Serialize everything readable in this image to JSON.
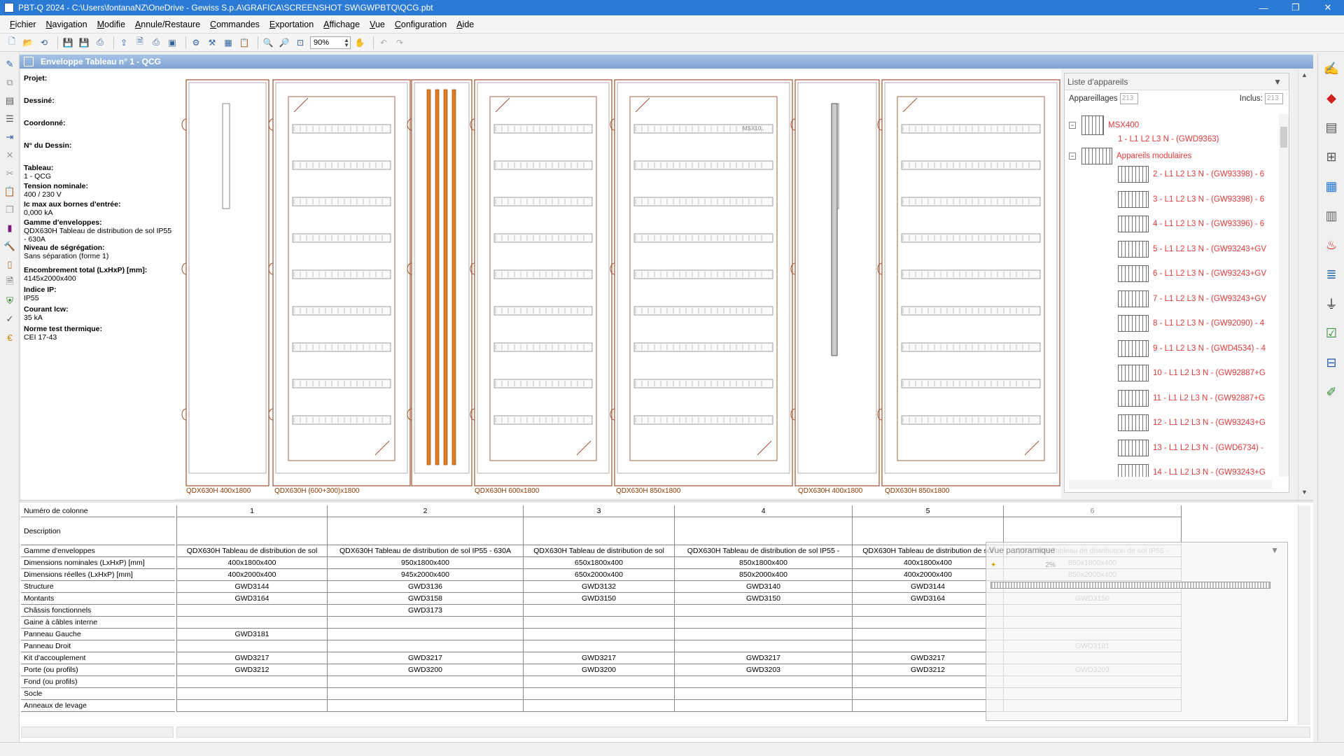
{
  "window": {
    "title": "PBT-Q 2024 - C:\\Users\\fontanaNZ\\OneDrive - Gewiss S.p.A\\GRAFICA\\SCREENSHOT SW\\GWPBTQ\\QCG.pbt",
    "minimize": "—",
    "maximize": "❐",
    "close": "✕"
  },
  "menu": [
    "Fichier",
    "Navigation",
    "Modifie",
    "Annule/Restaure",
    "Commandes",
    "Exportation",
    "Affichage",
    "Vue",
    "Configuration",
    "Aide"
  ],
  "toolbar": {
    "zoom": "90%"
  },
  "document": {
    "title": "Enveloppe Tableau n° 1 - QCG"
  },
  "info": {
    "projet_label": "Projet:",
    "dessine_label": "Dessiné:",
    "coordonne_label": "Coordonné:",
    "dessin_label": "N° du Dessin:",
    "tableau_label": "Tableau:",
    "tableau_value": "1 - QCG",
    "tension_label": "Tension nominale:",
    "tension_value": "400 / 230 V",
    "icmax_label": "Ic max aux bornes d'entrée:",
    "icmax_value": "0,000 kA",
    "gamme_label": "Gamme d'enveloppes:",
    "gamme_value": "QDX630H Tableau de distribution de sol IP55 - 630A",
    "niveau_label": "Niveau de ségrégation:",
    "niveau_value": "Sans séparation (forme 1)",
    "encombrement_label": "Encombrement total (LxHxP) [mm]:",
    "encombrement_value": "4145x2000x400",
    "ip_label": "Indice IP:",
    "ip_value": "IP55",
    "icw_label": "Courant Icw:",
    "icw_value": "35 kA",
    "norme_label": "Norme test thermique:",
    "norme_value": "CEI 17-43"
  },
  "columns_canvas": [
    {
      "label": "QDX630H 400x1800"
    },
    {
      "label": "QDX630H (600+300)x1800"
    },
    {
      "label": "QDX630H 600x1800"
    },
    {
      "label": "QDX630H 850x1800"
    },
    {
      "label": "QDX630H 400x1800"
    },
    {
      "label": "QDX630H 850x1800"
    }
  ],
  "canvas_tags": {
    "msx": "MSX10..",
    "msx2": "MSX400"
  },
  "device_list": {
    "title": "Liste d'appareils",
    "appareillages_label": "Appareillages",
    "appareillages_value": "213",
    "inclus_label": "Inclus:",
    "inclus_value": "213",
    "items": [
      {
        "text": "MSX400",
        "level": 0
      },
      {
        "text": "1 - L1 L2 L3 N - (GWD9363)",
        "level": 1
      },
      {
        "text": "Appareils modulaires",
        "level": 0
      },
      {
        "text": "2 - L1 L2 L3 N - (GW93398) - 6",
        "level": 2
      },
      {
        "text": "3 - L1 L2 L3 N - (GW93398) - 6",
        "level": 2
      },
      {
        "text": "4 - L1 L2 L3 N - (GW93396) - 6",
        "level": 2
      },
      {
        "text": "5 - L1 L2 L3 N - (GW93243+GV",
        "level": 2
      },
      {
        "text": "6 - L1 L2 L3 N - (GW93243+GV",
        "level": 2
      },
      {
        "text": "7 - L1 L2 L3 N - (GW93243+GV",
        "level": 2
      },
      {
        "text": "8 - L1 L2 L3 N - (GW92090) - 4",
        "level": 2
      },
      {
        "text": "9 - L1 L2 L3 N - (GWD4534) - 4",
        "level": 2
      },
      {
        "text": "10 - L1 L2 L3 N - (GW92887+G",
        "level": 2
      },
      {
        "text": "11 - L1 L2 L3 N - (GW92887+G",
        "level": 2
      },
      {
        "text": "12 - L1 L2 L3 N - (GW93243+G",
        "level": 2
      },
      {
        "text": "13 - L1 L2 L3 N - (GWD6734) -",
        "level": 2
      },
      {
        "text": "14 - L1 L2 L3 N - (GW93243+G",
        "level": 2
      }
    ]
  },
  "table": {
    "row_labels": [
      "Numéro de colonne",
      "Description",
      "Gamme d'enveloppes",
      "Dimensions nominales (LxHxP) [mm]",
      "Dimensions réelles (LxHxP) [mm]",
      "Structure",
      "Montants",
      "Châssis fonctionnels",
      "Gaine à câbles interne",
      "Panneau Gauche",
      "Panneau Droit",
      "Kit d'accouplement",
      "Porte (ou profils)",
      "Fond (ou profils)",
      "Socle",
      "Anneaux de levage"
    ],
    "columns": [
      {
        "num": "1",
        "desc": "",
        "gamme": "QDX630H Tableau de distribution de sol",
        "dimnom": "400x1800x400",
        "dimreel": "400x2000x400",
        "structure": "GWD3144",
        "montants": "GWD3164",
        "chassis": "",
        "gaine": "",
        "pgauche": "GWD3181",
        "pdroit": "",
        "kit": "GWD3217",
        "porte": "GWD3212",
        "fond": "",
        "socle": "",
        "anneaux": ""
      },
      {
        "num": "2",
        "desc": "",
        "gamme": "QDX630H Tableau de distribution de sol IP55 - 630A",
        "dimnom": "950x1800x400",
        "dimreel": "945x2000x400",
        "structure": "GWD3136",
        "montants": "GWD3158",
        "chassis": "GWD3173",
        "gaine": "",
        "pgauche": "",
        "pdroit": "",
        "kit": "GWD3217",
        "porte": "GWD3200",
        "fond": "",
        "socle": "",
        "anneaux": ""
      },
      {
        "num": "3",
        "desc": "",
        "gamme": "QDX630H Tableau de distribution de sol",
        "dimnom": "650x1800x400",
        "dimreel": "650x2000x400",
        "structure": "GWD3132",
        "montants": "GWD3150",
        "chassis": "",
        "gaine": "",
        "pgauche": "",
        "pdroit": "",
        "kit": "GWD3217",
        "porte": "GWD3200",
        "fond": "",
        "socle": "",
        "anneaux": ""
      },
      {
        "num": "4",
        "desc": "",
        "gamme": "QDX630H Tableau de distribution de sol IP55 -",
        "dimnom": "850x1800x400",
        "dimreel": "850x2000x400",
        "structure": "GWD3140",
        "montants": "GWD3150",
        "chassis": "",
        "gaine": "",
        "pgauche": "",
        "pdroit": "",
        "kit": "GWD3217",
        "porte": "GWD3203",
        "fond": "",
        "socle": "",
        "anneaux": ""
      },
      {
        "num": "5",
        "desc": "",
        "gamme": "QDX630H Tableau de distribution de sol",
        "dimnom": "400x1800x400",
        "dimreel": "400x2000x400",
        "structure": "GWD3144",
        "montants": "GWD3164",
        "chassis": "",
        "gaine": "",
        "pgauche": "",
        "pdroit": "",
        "kit": "GWD3217",
        "porte": "GWD3212",
        "fond": "",
        "socle": "",
        "anneaux": ""
      },
      {
        "num": "6",
        "desc": "",
        "gamme": "QDX630H Tableau de distribution de sol IP55 -",
        "dimnom": "850x1800x400",
        "dimreel": "850x2000x400",
        "structure": "GWD3140",
        "montants": "GWD3150",
        "chassis": "",
        "gaine": "",
        "pgauche": "",
        "pdroit": "GWD3181",
        "kit": "",
        "porte": "GWD3203",
        "fond": "",
        "socle": "",
        "anneaux": ""
      }
    ]
  },
  "panorama": {
    "title": "Vue panoramique",
    "zoom": "2%"
  }
}
